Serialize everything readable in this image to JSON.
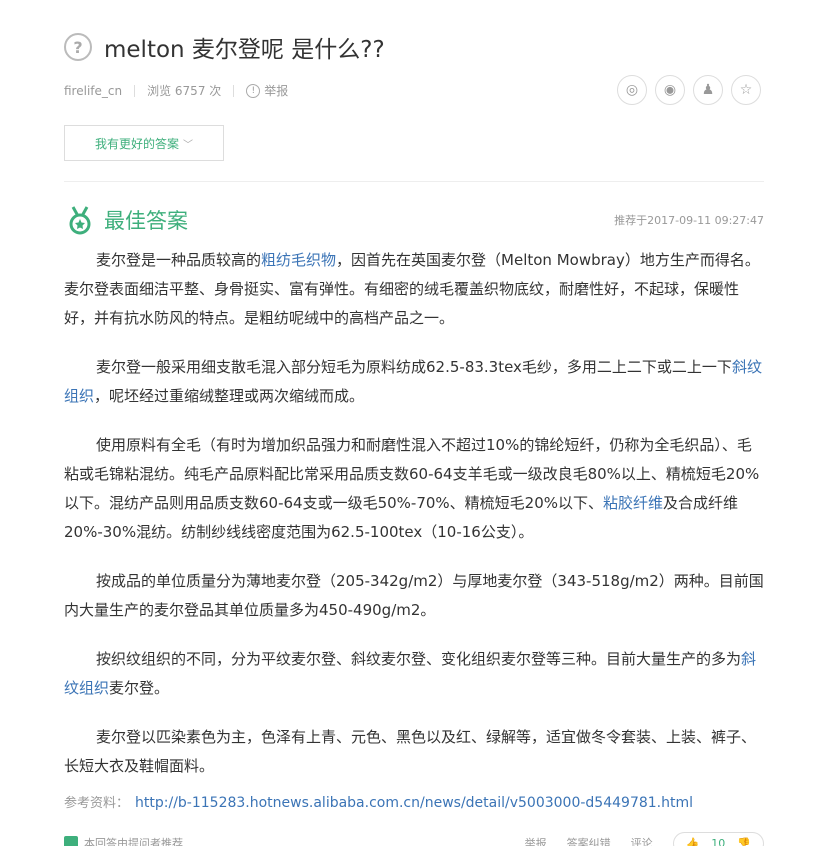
{
  "question": {
    "title": "melton 麦尔登呢 是什么??",
    "user": "firelife_cn",
    "views": "浏览 6757 次",
    "report": "举报"
  },
  "better_answer_label": "我有更好的答案",
  "best_answer": {
    "title": "最佳答案",
    "recommended": "推荐于2017-09-11 09:27:47"
  },
  "reference": {
    "label": "参考资料：",
    "url": "http://b-115283.hotnews.alibaba.com.cn/news/detail/v5003000-d5449781.html"
  },
  "footer": {
    "endorse": "本回答由提问者推荐",
    "report": "举报",
    "correct": "答案纠错",
    "comment": "评论",
    "votes": "10"
  },
  "colors": {
    "accent": "#3eaf7c",
    "link": "#3b74b6"
  }
}
